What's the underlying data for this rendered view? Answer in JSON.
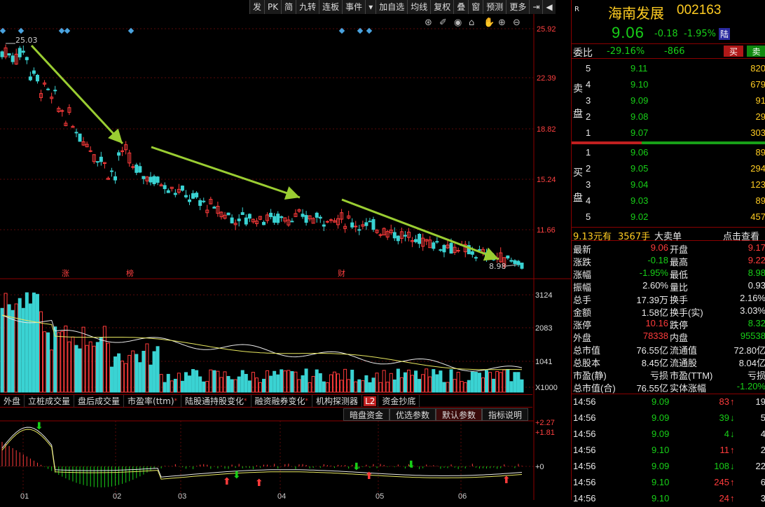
{
  "toolbar": [
    "发",
    "PK",
    "简",
    "九转",
    "连板",
    "事件",
    "▾",
    "加自选",
    "均线",
    "复权",
    "叠",
    "窗",
    "预测",
    "更多",
    "⇥",
    "◀"
  ],
  "price_axis": [
    "25.92",
    "22.39",
    "18.82",
    "15.24",
    "11.66"
  ],
  "vol_axis": [
    "3124",
    "2083",
    "1041",
    "X1000"
  ],
  "macd_axis": [
    "+2.27",
    "+1.81",
    "+0"
  ],
  "markers": {
    "high": "25.03",
    "low": "8.98",
    "m1": "涨",
    "m2": "榜",
    "m3": "财"
  },
  "time_labels": [
    "01",
    "02",
    "03",
    "04",
    "05",
    "06"
  ],
  "indicator_tabs": [
    "外盘",
    "立桩成交量",
    "盘后成交量",
    "市盈率(ttm)",
    "陆股通持股变化",
    "融资融券变化",
    "机构探测器",
    "L2",
    "资金抄底"
  ],
  "param_tabs": [
    "暗盘资金",
    "优选参数",
    "默认参数",
    "指标说明"
  ],
  "stock": {
    "flag": "R",
    "name": "海南发展",
    "code": "002163",
    "price": "9.06",
    "change": "-0.18",
    "pct": "-1.95%",
    "tag": "陆"
  },
  "weibi": {
    "label": "委比",
    "pct": "-29.16%",
    "diff": "-866",
    "buy": "买",
    "sell": "卖"
  },
  "sell_label": [
    "卖",
    "盘"
  ],
  "buy_label": [
    "买",
    "盘"
  ],
  "asks": [
    {
      "lvl": "5",
      "price": "9.11",
      "vol": "820"
    },
    {
      "lvl": "4",
      "price": "9.10",
      "vol": "679"
    },
    {
      "lvl": "3",
      "price": "9.09",
      "vol": "91"
    },
    {
      "lvl": "2",
      "price": "9.08",
      "vol": "29"
    },
    {
      "lvl": "1",
      "price": "9.07",
      "vol": "303"
    }
  ],
  "bids": [
    {
      "lvl": "1",
      "price": "9.06",
      "vol": "89"
    },
    {
      "lvl": "2",
      "price": "9.05",
      "vol": "294"
    },
    {
      "lvl": "3",
      "price": "9.04",
      "vol": "123"
    },
    {
      "lvl": "4",
      "price": "9.03",
      "vol": "89"
    },
    {
      "lvl": "5",
      "price": "9.02",
      "vol": "457"
    }
  ],
  "bigorder": {
    "price": "9.13元有",
    "vol": "3567手",
    "label": "大卖单",
    "link": "点击查看"
  },
  "stats": [
    {
      "k1": "最新",
      "v1": "9.06",
      "c1": "red",
      "k2": "开盘",
      "v2": "9.17",
      "c2": "red"
    },
    {
      "k1": "涨跌",
      "v1": "-0.18",
      "c1": "green",
      "k2": "最高",
      "v2": "9.22",
      "c2": "red"
    },
    {
      "k1": "涨幅",
      "v1": "-1.95%",
      "c1": "green",
      "k2": "最低",
      "v2": "8.98",
      "c2": "green"
    },
    {
      "k1": "振幅",
      "v1": "2.60%",
      "c1": "white",
      "k2": "量比",
      "v2": "0.93",
      "c2": "white"
    },
    {
      "k1": "总手",
      "v1": "17.39万",
      "c1": "white",
      "k2": "换手",
      "v2": "2.16%",
      "c2": "white"
    },
    {
      "k1": "金额",
      "v1": "1.58亿",
      "c1": "white",
      "k2": "换手(实)",
      "v2": "3.03%",
      "c2": "white"
    },
    {
      "k1": "涨停",
      "v1": "10.16",
      "c1": "red",
      "k2": "跌停",
      "v2": "8.32",
      "c2": "green"
    },
    {
      "k1": "外盘",
      "v1": "78338",
      "c1": "red",
      "k2": "内盘",
      "v2": "95538",
      "c2": "green"
    },
    {
      "k1": "总市值",
      "v1": "76.55亿",
      "c1": "white",
      "k2": "流通值",
      "v2": "72.80亿",
      "c2": "white"
    },
    {
      "k1": "总股本",
      "v1": "8.45亿",
      "c1": "white",
      "k2": "流通股",
      "v2": "8.04亿",
      "c2": "white"
    },
    {
      "k1": "市盈(静)",
      "v1": "亏损",
      "c1": "white",
      "k2": "市盈(TTM)",
      "v2": "亏损",
      "c2": "white"
    },
    {
      "k1": "总市值(合)",
      "v1": "76.55亿",
      "c1": "white",
      "k2": "实体涨幅",
      "v2": "-1.20%",
      "c2": "green"
    }
  ],
  "ticks": [
    {
      "t": "14:56",
      "p": "9.09",
      "v": "83",
      "dir": "up",
      "n": "19"
    },
    {
      "t": "14:56",
      "p": "9.09",
      "v": "39",
      "dir": "down",
      "n": "5"
    },
    {
      "t": "14:56",
      "p": "9.09",
      "v": "4",
      "dir": "down",
      "n": "4"
    },
    {
      "t": "14:56",
      "p": "9.10",
      "v": "11",
      "dir": "up",
      "n": "2"
    },
    {
      "t": "14:56",
      "p": "9.09",
      "v": "108",
      "dir": "down",
      "n": "22"
    },
    {
      "t": "14:56",
      "p": "9.10",
      "v": "245",
      "dir": "up",
      "n": "6"
    },
    {
      "t": "14:56",
      "p": "9.10",
      "v": "24",
      "dir": "up",
      "n": "3"
    }
  ],
  "colors": {
    "up": "#ff3b3b",
    "down": "#3ad3d3",
    "panel_border": "#8b0000",
    "arrow": "#9acd32"
  }
}
